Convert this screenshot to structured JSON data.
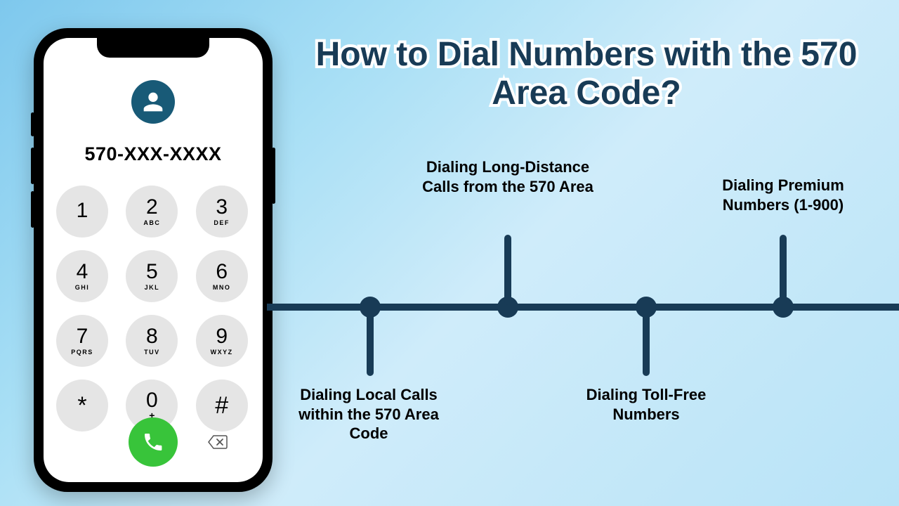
{
  "title": "How to Dial Numbers with the 570 Area Code?",
  "phone": {
    "number": "570-XXX-XXXX",
    "keys": [
      {
        "main": "1",
        "sub": ""
      },
      {
        "main": "2",
        "sub": "ABC"
      },
      {
        "main": "3",
        "sub": "DEF"
      },
      {
        "main": "4",
        "sub": "GHI"
      },
      {
        "main": "5",
        "sub": "JKL"
      },
      {
        "main": "6",
        "sub": "MNO"
      },
      {
        "main": "7",
        "sub": "PQRS"
      },
      {
        "main": "8",
        "sub": "TUV"
      },
      {
        "main": "9",
        "sub": "WXYZ"
      },
      {
        "main": "*",
        "sub": ""
      },
      {
        "main": "0",
        "sub": "+"
      },
      {
        "main": "#",
        "sub": ""
      }
    ]
  },
  "timeline": {
    "items": [
      {
        "label": "Dialing Local Calls within the 570 Area Code",
        "pos": "down"
      },
      {
        "label": "Dialing Long-Distance Calls from the 570 Area",
        "pos": "up"
      },
      {
        "label": "Dialing Toll-Free Numbers",
        "pos": "down"
      },
      {
        "label": "Dialing Premium Numbers (1-900)",
        "pos": "up"
      }
    ]
  },
  "colors": {
    "accent": "#183b56",
    "call": "#38c43a"
  }
}
